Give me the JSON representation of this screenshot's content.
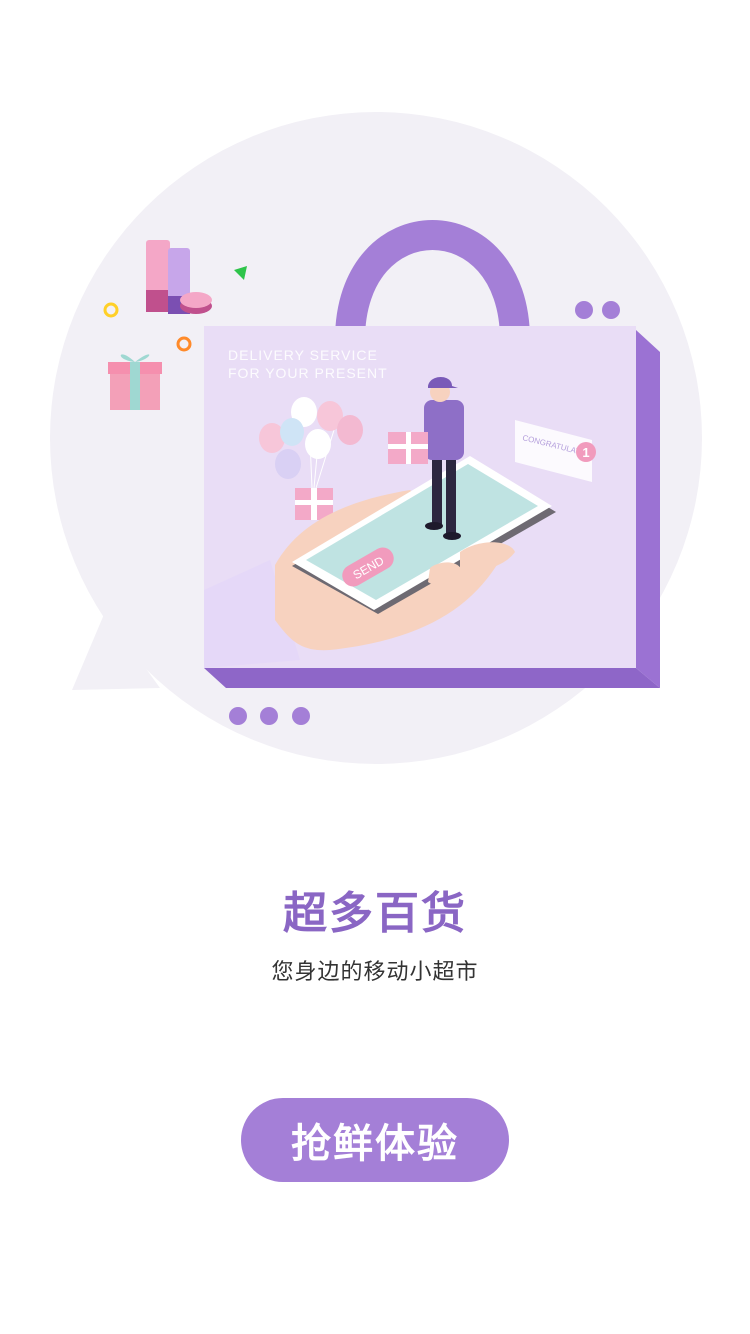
{
  "hero": {
    "phone_button_text": "SEND",
    "headline_line1": "DELIVERY SERVICE",
    "headline_line2": "FOR YOUR PRESENT",
    "notification_text": "CONGRATULATION",
    "notification_badge": "1"
  },
  "page": {
    "title": "超多百货",
    "subtitle": "您身边的移动小超市"
  },
  "cta": {
    "label": "抢鲜体验"
  },
  "colors": {
    "accent": "#a47fd7",
    "title": "#8a66c4",
    "bubble": "#f2f0f6"
  }
}
